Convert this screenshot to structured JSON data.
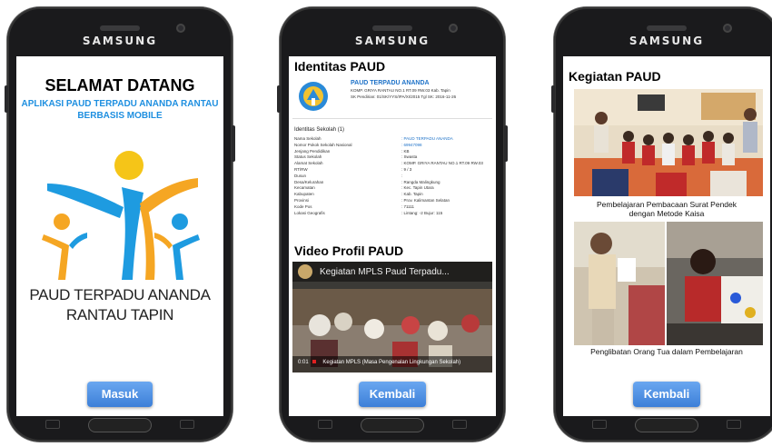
{
  "brand": "SAMSUNG",
  "screen1": {
    "title": "SELAMAT DATANG",
    "subtitle_line1": "APLIKASI PAUD TERPADU ANANDA RANTAU",
    "subtitle_line2": "BERBASIS MOBILE",
    "logo_line1": "PAUD TERPADU ANANDA",
    "logo_line2": "RANTAU TAPIN",
    "button": "Masuk"
  },
  "screen2": {
    "title": "Identitas PAUD",
    "school_name": "PAUD TERPADU ANANDA",
    "school_address": "KOMP. GRIYA RANTAU NO.1 RT.09 RW.03 Kab. Tapin",
    "school_sk": "SK Pendirian: 01/SK/YYS/IPA/XI/2015 Tgl SK: 2016-11-26",
    "section_title": "Identitas Sekolah (1)",
    "rows": [
      {
        "k": "Nama Sekolah",
        "v": ": PAUD TERPADU ANANDA"
      },
      {
        "k": "Nomor Pokok Sekolah Nasional",
        "v": ": 69947098"
      },
      {
        "k": "Jenjang Pendidikan",
        "v": ": KB"
      },
      {
        "k": "Status Sekolah",
        "v": ": Swasta"
      },
      {
        "k": "Alamat Sekolah",
        "v": ": KOMP. GRIYA RANTAU NO.1 RT.09 RW.03"
      },
      {
        "k": "RT/RW",
        "v": ": 9 / 3"
      },
      {
        "k": "Dusun",
        "v": ":"
      },
      {
        "k": "Desa/Kelurahan",
        "v": ": Rangda Malingkung"
      },
      {
        "k": "Kecamatan",
        "v": ": Kec. Tapin Utara"
      },
      {
        "k": "Kabupaten",
        "v": ": Kab. Tapin"
      },
      {
        "k": "Provinsi",
        "v": ": Prov. Kalimantan Selatan"
      },
      {
        "k": "Kode Pos",
        "v": ": 71111"
      },
      {
        "k": "Lokasi Geografis",
        "v": ": Lintang: -2 Bujur: 115"
      }
    ],
    "video_heading": "Video Profil PAUD",
    "video_title": "Kegiatan MPLS Paud Terpadu...",
    "video_time": "0:01",
    "video_caption": "Kegiatan MPLS (Masa Pengenalan Lingkungan Sekolah)",
    "button": "Kembali"
  },
  "screen3": {
    "title": "Kegiatan PAUD",
    "caption1_line1": "Pembelajaran Pembacaan Surat Pendek",
    "caption1_line2": "dengan Metode Kaisa",
    "caption2": "Penglibatan Orang Tua dalam Pembelajaran",
    "button": "Kembali"
  }
}
